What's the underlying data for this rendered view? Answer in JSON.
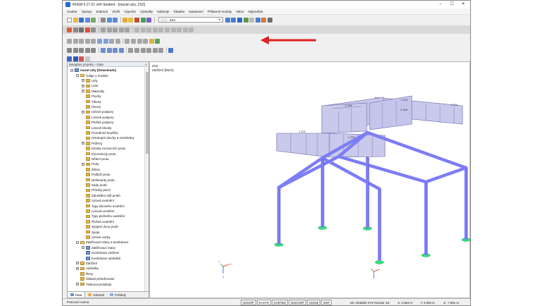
{
  "window": {
    "title": "RFEM 5.27.01 x64 Student - [mazat uzly, ZS2]"
  },
  "menubar": [
    "Soubor",
    "Úpravy",
    "Zobrazit",
    "Vložit",
    "Výpočet",
    "Výsledky",
    "Nástroje",
    "Tabulka",
    "Nastavení",
    "Přídavné moduly",
    "Okno",
    "Nápověda"
  ],
  "toolbar": {
    "loadcase_label": "ZS2",
    "loadcase_code": "ZS2"
  },
  "navigator": {
    "title": "Navigátor projektu - Data",
    "tree": [
      {
        "label": "mazat uzly [Downloads]",
        "level": 0,
        "type": "root",
        "expanded": true,
        "bold": true
      },
      {
        "label": "Údaje o modelu",
        "level": 1,
        "type": "folder-open",
        "expanded": true
      },
      {
        "label": "Uzly",
        "level": 2,
        "type": "folder",
        "collapsed": true
      },
      {
        "label": "Linie",
        "level": 2,
        "type": "folder",
        "collapsed": true
      },
      {
        "label": "Materiály",
        "level": 2,
        "type": "folder",
        "collapsed": true
      },
      {
        "label": "Plochy",
        "level": 2,
        "type": "folder"
      },
      {
        "label": "Tělesa",
        "level": 2,
        "type": "folder"
      },
      {
        "label": "Otvory",
        "level": 2,
        "type": "folder"
      },
      {
        "label": "Uzlové podpory",
        "level": 2,
        "type": "folder",
        "collapsed": true
      },
      {
        "label": "Liniové podpory",
        "level": 2,
        "type": "folder"
      },
      {
        "label": "Plošné podpory",
        "level": 2,
        "type": "folder"
      },
      {
        "label": "Liniové klouby",
        "level": 2,
        "type": "folder"
      },
      {
        "label": "Proměnné tloušťky",
        "level": 2,
        "type": "folder"
      },
      {
        "label": "Ortotropní plochy a membrány",
        "level": 2,
        "type": "folder"
      },
      {
        "label": "Průřezy",
        "level": 2,
        "type": "folder",
        "collapsed": true
      },
      {
        "label": "Klouby na koncích prutu",
        "level": 2,
        "type": "folder"
      },
      {
        "label": "Excentricity prutu",
        "level": 2,
        "type": "folder"
      },
      {
        "label": "Dělení prutu",
        "level": 2,
        "type": "folder"
      },
      {
        "label": "Pruty",
        "level": 2,
        "type": "folder",
        "collapsed": true
      },
      {
        "label": "Žebra",
        "level": 2,
        "type": "folder"
      },
      {
        "label": "Podloží prutu",
        "level": 2,
        "type": "folder"
      },
      {
        "label": "Nelinearity prutu",
        "level": 2,
        "type": "folder"
      },
      {
        "label": "Sady prutů",
        "level": 2,
        "type": "folder"
      },
      {
        "label": "Průniky ploch",
        "level": 2,
        "type": "folder"
      },
      {
        "label": "Zahuštění sítě prvků",
        "level": 2,
        "type": "folder"
      },
      {
        "label": "Uzlová uvolnění",
        "level": 2,
        "type": "folder"
      },
      {
        "label": "Typy liniového uvolnění",
        "level": 2,
        "type": "folder"
      },
      {
        "label": "Liniová uvolnění",
        "level": 2,
        "type": "folder"
      },
      {
        "label": "Typy plošného uvolnění",
        "level": 2,
        "type": "folder"
      },
      {
        "label": "Plošná uvolnění",
        "level": 2,
        "type": "folder"
      },
      {
        "label": "Spojení dvou prutů",
        "level": 2,
        "type": "folder"
      },
      {
        "label": "Spoje",
        "level": 2,
        "type": "folder"
      },
      {
        "label": "Uzlové vazby",
        "level": 2,
        "type": "folder"
      },
      {
        "label": "Zatěžovací stavy a kombinace",
        "level": 1,
        "type": "folder-open",
        "expanded": true
      },
      {
        "label": "Zatěžovací stavy",
        "level": 2,
        "type": "icon",
        "collapsed": true
      },
      {
        "label": "Kombinace zatížení",
        "level": 2,
        "type": "icon"
      },
      {
        "label": "Kombinace výsledků",
        "level": 2,
        "type": "icon"
      },
      {
        "label": "Zatížení",
        "level": 1,
        "type": "folder",
        "collapsed": true
      },
      {
        "label": "Výsledky",
        "level": 1,
        "type": "folder",
        "collapsed": true
      },
      {
        "label": "Řezy",
        "level": 1,
        "type": "folder"
      },
      {
        "label": "Oblasti průměrování",
        "level": 1,
        "type": "folder"
      },
      {
        "label": "Tisknout protokoly",
        "level": 1,
        "type": "folder",
        "collapsed": true
      }
    ],
    "tabs": [
      "Data",
      "Zobrazit",
      "Pohledy"
    ]
  },
  "view": {
    "lc_line1": "ZS2",
    "lc_line2": "Zatížení [kN/m]",
    "load_labels": [
      "1.220",
      "2.456",
      "1.220",
      "1.220",
      "2.456",
      "1.220"
    ],
    "axes": [
      "X",
      "Y",
      "Z"
    ]
  },
  "statusbar": {
    "message": "Pracovní rovina",
    "buttons": [
      "UCHOP",
      "RASTR",
      "KARTEZ",
      "OUCHOP",
      "VLINIE",
      "DXF"
    ],
    "plane": "SS: Globální XYZ  Rovina: XZ",
    "x": "X: 3.384 m",
    "y": "Y: 0.000 m",
    "z": "Z: -7.861 m"
  },
  "colors": {
    "member": "#7d7df5",
    "member_edge": "#3b3bd6",
    "load": "#c9c9ec",
    "load_edge": "#6262a6",
    "support": "#2ee878",
    "arrow": "#e02020"
  }
}
